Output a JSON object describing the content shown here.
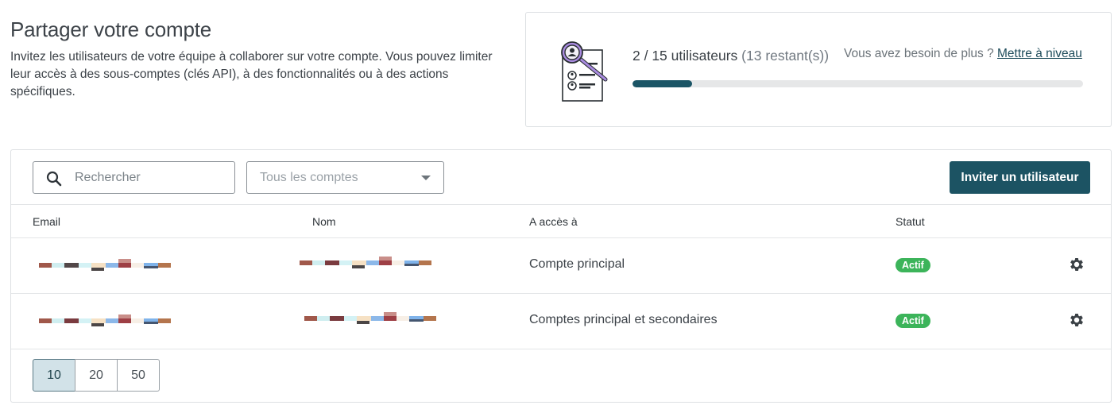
{
  "header": {
    "title": "Partager votre compte",
    "description": "Invitez les utilisateurs de votre équipe à collaborer sur votre compte. Vous pouvez limiter leur accès à des sous-comptes (clés API), à des fonctionnalités ou à des actions spécifiques."
  },
  "quota": {
    "used_total": "2 / 15 utilisateurs",
    "remaining": "(13 restant(s))",
    "need_more": "Vous avez besoin de plus ?",
    "upgrade_label": "Mettre à niveau",
    "progress_fraction": 0.133,
    "bar_color": "#1b5566"
  },
  "toolbar": {
    "search_placeholder": "Rechercher",
    "account_filter": "Tous les comptes",
    "invite_label": "Inviter un utilisateur",
    "accent_color": "#1c5363"
  },
  "table": {
    "columns": {
      "email": "Email",
      "name": "Nom",
      "access": "A accès à",
      "status": "Statut"
    },
    "rows": [
      {
        "access": "Compte principal",
        "status": "Actif"
      },
      {
        "access": "Comptes principal et secondaires",
        "status": "Actif"
      }
    ]
  },
  "pagination": {
    "sizes": [
      "10",
      "20",
      "50"
    ],
    "selected": "10"
  },
  "icons": {
    "search": "search-icon",
    "dropdown": "chevron-down-icon",
    "settings": "gear-icon",
    "illustration": "user-document-magnifier-icon"
  },
  "status_color": "#3cb45a"
}
